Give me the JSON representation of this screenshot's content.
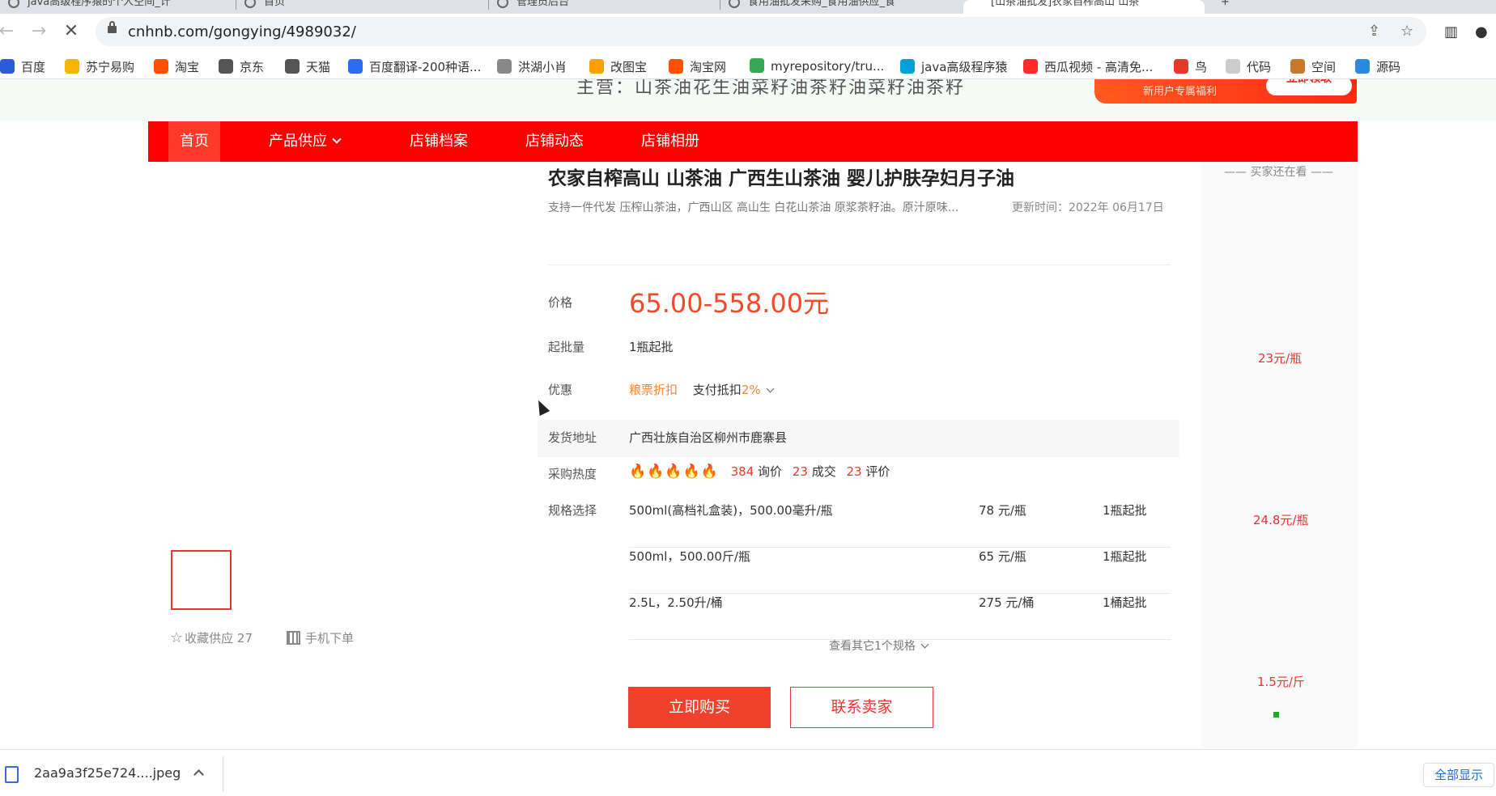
{
  "browser": {
    "tabs": [
      {
        "label": "java高级程序猿的个人空间_计"
      },
      {
        "label": "首页"
      },
      {
        "label": "管理员后台"
      },
      {
        "label": "食用油批发采购_食用油供应_食"
      },
      {
        "label": "[山茶油批发]农家自榨高山 山茶"
      }
    ],
    "url": "cnhnb.com/gongying/4989032/",
    "bookmarks": [
      {
        "label": "百度",
        "color": "#2b5cd8"
      },
      {
        "label": "苏宁易购",
        "color": "#f7b500"
      },
      {
        "label": "淘宝",
        "color": "#ff5000"
      },
      {
        "label": "京东",
        "color": "#555555"
      },
      {
        "label": "天猫",
        "color": "#555555"
      },
      {
        "label": "百度翻译-200种语...",
        "color": "#2b6cf0"
      },
      {
        "label": "洪湖小肖",
        "color": "#888888"
      },
      {
        "label": "改图宝",
        "color": "#ff9f00"
      },
      {
        "label": "淘宝网",
        "color": "#ff5000"
      },
      {
        "label": "myrepository/tru...",
        "color": "#34a853"
      },
      {
        "label": "java高级程序猿",
        "color": "#00a1d6"
      },
      {
        "label": "西瓜视频 - 高清免...",
        "color": "#ff2a2a"
      },
      {
        "label": "鸟",
        "color": "#e33a2a"
      },
      {
        "label": "代码",
        "color": "#cccccc"
      },
      {
        "label": "空间",
        "color": "#c87a2a"
      },
      {
        "label": "源码",
        "color": "#2a8ae0"
      }
    ]
  },
  "header": {
    "ad_text": "主营：山茶油花生油菜籽油茶籽油菜籽油茶籽",
    "promo_text": "新用户专属福利",
    "promo_button": "立即领取"
  },
  "nav": {
    "items": [
      "首页",
      "产品供应",
      "店铺档案",
      "店铺动态",
      "店铺相册"
    ]
  },
  "product": {
    "title": "农家自榨高山 山茶油 广西生山茶油 婴儿护肤孕妇月子油",
    "subtitle": "支持一件代发 压榨山茶油，广西山区 高山生 白花山茶油 原浆茶籽油。原汁原味...",
    "updated": "更新时间：2022年 06月17日",
    "labels": {
      "price": "价格",
      "moq": "起批量",
      "promo": "优惠",
      "ship_from": "发货地址",
      "heat": "采购热度",
      "spec": "规格选择"
    },
    "price": "65.00-558.00元",
    "moq": "1瓶起批",
    "promo_tag": "粮票折扣",
    "promo_pay": "支付抵扣",
    "promo_pct": "2%",
    "ship_from": "广西壮族自治区柳州市鹿寨县",
    "heat_icons": "🔥🔥🔥🔥🔥",
    "inquiries": "384",
    "inquiries_label": "询价",
    "deals": "23",
    "deals_label": "成交",
    "reviews": "23",
    "reviews_label": "评价",
    "specs": [
      {
        "name": "500ml(高档礼盒装)，500.00毫升/瓶",
        "price": "78 元/瓶",
        "moq": "1瓶起批"
      },
      {
        "name": "500ml，500.00斤/瓶",
        "price": "65 元/瓶",
        "moq": "1瓶起批"
      },
      {
        "name": "2.5L，2.50升/桶",
        "price": "275 元/桶",
        "moq": "1桶起批"
      }
    ],
    "more_specs": "查看其它1个规格",
    "buy_button": "立即购买",
    "contact_button": "联系卖家",
    "favorite": "收藏供应 27",
    "mobile_order": "手机下单"
  },
  "sidebar": {
    "title": "—— 买家还在看 ——",
    "prices": [
      "23元/瓶",
      "24.8元/瓶",
      "1.5元/斤"
    ]
  },
  "downloads": {
    "file": "2aa9a3f25e724....jpeg",
    "show_all": "全部显示"
  }
}
